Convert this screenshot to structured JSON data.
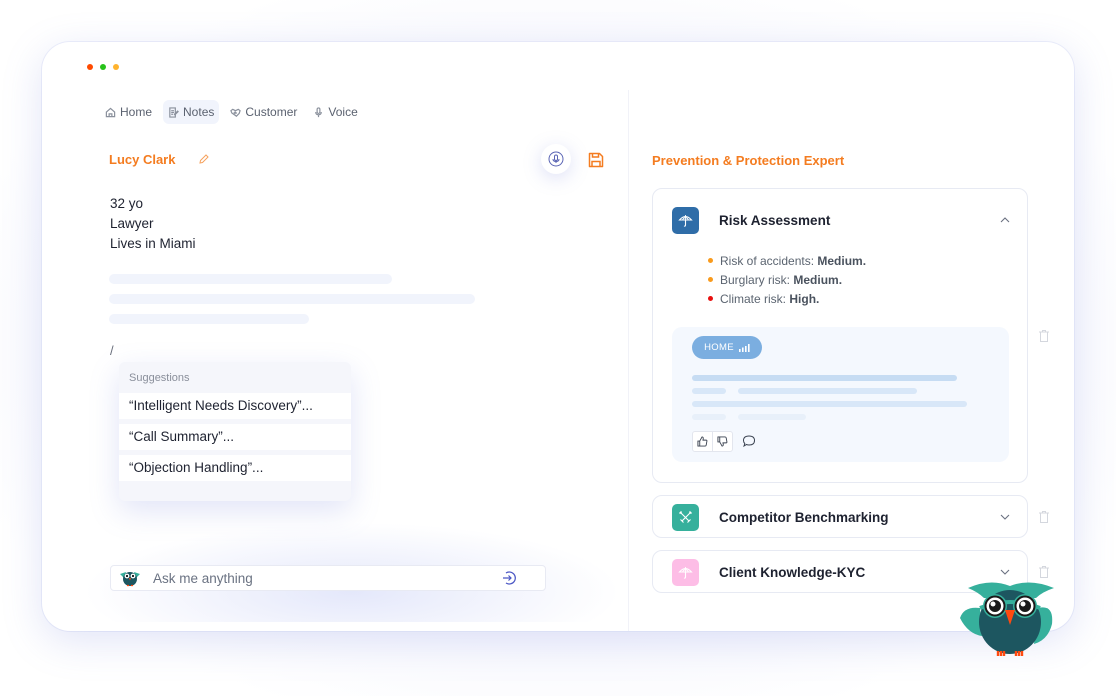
{
  "window": {
    "traffic_lights": [
      {
        "name": "close",
        "color": "#ff4a00"
      },
      {
        "name": "minimize",
        "color": "#27c21a"
      },
      {
        "name": "maximize",
        "color": "#ffb32e"
      }
    ]
  },
  "nav": {
    "items": [
      {
        "label": "Home",
        "icon": "home-icon",
        "active": false
      },
      {
        "label": "Notes",
        "icon": "notes-icon",
        "active": true
      },
      {
        "label": "Customer",
        "icon": "handshake-icon",
        "active": false
      },
      {
        "label": "Voice",
        "icon": "microphone-icon",
        "active": false
      }
    ]
  },
  "notes": {
    "customer_name": "Lucy Clark",
    "details": [
      "32 yo",
      "Lawyer",
      "Lives in Miami"
    ],
    "slash_command": "/",
    "suggestions": {
      "header": "Suggestions",
      "items": [
        "“Intelligent Needs Discovery”...",
        "“Call Summary”...",
        "“Objection Handling”..."
      ]
    }
  },
  "ask": {
    "placeholder": "Ask me anything",
    "value": ""
  },
  "expert": {
    "title": "Prevention & Protection Expert",
    "cards": [
      {
        "title": "Risk Assessment",
        "icon": "umbrella-icon",
        "icon_color": "#2f6da8",
        "expanded": true,
        "risks": [
          {
            "label": "Risk of accidents:",
            "level": "Medium.",
            "color": "#f99a1c"
          },
          {
            "label": "Burglary risk:",
            "level": "Medium.",
            "color": "#f99a1c"
          },
          {
            "label": "Climate risk:",
            "level": "High.",
            "color": "#e8100f"
          }
        ],
        "tag": "HOME"
      },
      {
        "title": "Competitor Benchmarking",
        "icon": "crossed-swords-icon",
        "icon_color": "#36b09c",
        "expanded": false
      },
      {
        "title": "Client Knowledge-KYC",
        "icon": "umbrella-icon",
        "icon_color": "#fdbde6",
        "expanded": false
      }
    ]
  },
  "colors": {
    "accent": "#f47c20",
    "primary_blue": "#2f6da8",
    "teal": "#36b09c"
  }
}
